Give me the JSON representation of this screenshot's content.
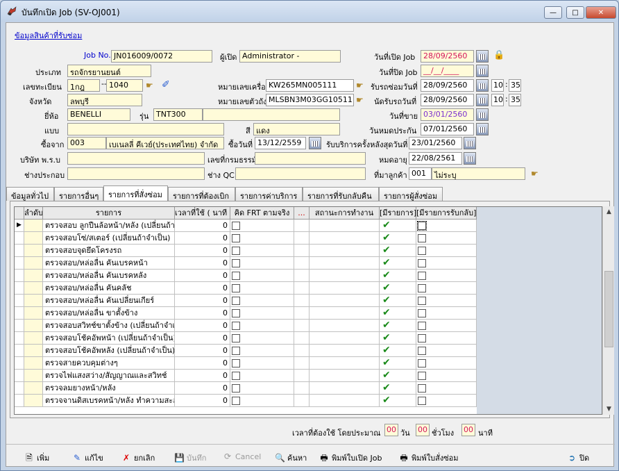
{
  "window": {
    "title": "บันทึกเปิด Job (SV-OJ001)",
    "controls": [
      "minimize",
      "maximize",
      "close"
    ]
  },
  "section_link": "ข้อมูลสินค้าที่รับซ่อม",
  "form": {
    "job_no_label": "Job No.",
    "job_no": "JN016009/0072",
    "opener_label": "ผู้เปิด",
    "opener": "Administrator -",
    "open_date_label": "วันที่เปิด Job",
    "open_date": "28/09/2560",
    "close_date_label": "วันที่ปิด Job",
    "close_date": "__/__/____",
    "type_label": "ประเภท",
    "type": "รถจักรยานยนต์",
    "plate_label": "เลขทะเบียน",
    "plate_prefix": "1กฎ",
    "plate_sep": "--",
    "plate_number": "1040",
    "engine_label": "หมายเลขเครื่อง",
    "engine_no": "KW265MN005111",
    "receive_date_label": "รับรถซ่อมวันที่",
    "receive_date": "28/09/2560",
    "receive_hour": "10",
    "receive_min": "35",
    "time_sep": ":",
    "province_label": "จังหวัด",
    "province": "ลพบุรี",
    "chassis_label": "หมายเลขตัวถัง",
    "chassis_no": "MLSBN3M03GG105111",
    "appoint_date_label": "นัดรับรถวันที่",
    "appoint_date": "28/09/2560",
    "appoint_hour": "10",
    "appoint_min": "35",
    "brand_label": "ยี่ห้อ",
    "brand": "BENELLI",
    "model_label": "รุ่น",
    "model": "TNT300",
    "sold_date_label": "วันที่ขาย",
    "sold_date": "03/01/2560",
    "style_label": "แบบ",
    "style": "",
    "color_label": "สี",
    "color": "แดง",
    "warranty_exp_label": "วันหมดประกัน",
    "warranty_exp": "07/01/2560",
    "buy_from_label": "ซื้อจาก",
    "buy_from_code": "003",
    "buy_from_name": "เบเนลลี่ คีเวย์(ประเทศไทย) จำกัด",
    "buy_date_label": "ซื้อวันที่",
    "buy_date": "13/12/2559",
    "last_service_label": "รับบริการครั้งหลังสุดวันที่",
    "last_service_date": "23/01/2560",
    "insurer_label": "บริษัท พ.ร.บ",
    "insurer": "",
    "policy_label": "เลขที่กรมธรรม์",
    "policy_no": "",
    "expire_label": "หมดอายุ",
    "expire_date": "22/08/2561",
    "assembler_label": "ช่างประกอบ",
    "assembler": "",
    "qc_label": "ช่าง QC",
    "qc": "",
    "customer_source_label": "ที่มาลูกค้า",
    "customer_source_code": "001",
    "customer_source_name": "ไม่ระบุ"
  },
  "tabs": [
    "ข้อมูลทั่วไป",
    "รายการอื่นๆ",
    "รายการที่สั่งซ่อม",
    "รายการที่ต้องเบิก",
    "รายการค่าบริการ",
    "รายการที่รับกลับคืน",
    "รายการผู้สั่งซ่อม"
  ],
  "active_tab": "รายการที่สั่งซ่อม",
  "grid": {
    "columns": [
      "ลำดับ",
      "รายการ",
      "เวลาที่ใช้ ( นาที )",
      "คิด FRT ตามจริง",
      "...",
      "สถานะการทำงาน",
      "[มีรายการ]",
      "[มีรายการรับกลับ]"
    ],
    "rows": [
      {
        "item": "ตรวจสอบ ลูกปืนล้อหน้า/หลัง (เปลี่ยนถ้าจำเป็น)",
        "minutes": "0",
        "has_item": true
      },
      {
        "item": "ตรวจสอบโซ่/สเตอร์ (เปลี่ยนถ้าจำเป็น)",
        "minutes": "0",
        "has_item": true
      },
      {
        "item": "ตรวจสอบจุดยึดโครงรถ",
        "minutes": "0",
        "has_item": true
      },
      {
        "item": "ตรวจสอบ/หล่อลื่น คันเบรคหน้า",
        "minutes": "0",
        "has_item": true
      },
      {
        "item": "ตรวจสอบ/หล่อลื่น คันเบรคหลัง",
        "minutes": "0",
        "has_item": true
      },
      {
        "item": "ตรวจสอบ/หล่อลื่น คันคลัช",
        "minutes": "0",
        "has_item": true
      },
      {
        "item": "ตรวจสอบ/หล่อลื่น คันเปลี่ยนเกียร์",
        "minutes": "0",
        "has_item": true
      },
      {
        "item": "ตรวจสอบ/หล่อลื่น ขาตั้งข้าง",
        "minutes": "0",
        "has_item": true
      },
      {
        "item": "ตรวจสอบสวิทช์ขาตั้งข้าง (เปลี่ยนถ้าจำเป็น)",
        "minutes": "0",
        "has_item": true
      },
      {
        "item": "ตรวจสอบโช้คอัพหน้า (เปลี่ยนถ้าจำเป็น)",
        "minutes": "0",
        "has_item": true
      },
      {
        "item": "ตรวจสอบโช้คอัพหลัง (เปลี่ยนถ้าจำเป็น)",
        "minutes": "0",
        "has_item": true
      },
      {
        "item": "ตรวจสายควบคุมต่างๆ",
        "minutes": "0",
        "has_item": true
      },
      {
        "item": "ตรวจไฟแสงสว่าง/สัญญาณและสวิทช์",
        "minutes": "0",
        "has_item": true
      },
      {
        "item": "ตรวจลมยางหน้า/หลัง",
        "minutes": "0",
        "has_item": true
      },
      {
        "item": "ตรวจจานดิสเบรคหน้า/หลัง ทำความสะอาด",
        "minutes": "0",
        "has_item": true
      }
    ]
  },
  "summary": {
    "label": "เวลาที่ต้องใช้ โดยประมาณ",
    "days": "00",
    "days_unit": "วัน",
    "hours": "00",
    "hours_unit": "ชั่วโมง",
    "minutes": "00",
    "minutes_unit": "นาที"
  },
  "toolbar": {
    "add": "เพิ่ม",
    "edit": "แก้ไข",
    "cancel_record": "ยกเลิก",
    "save": "บันทึก",
    "cancel": "Cancel",
    "search": "ค้นหา",
    "print_job": "พิมพ์ใบเปิด Job",
    "print_order": "พิมพ์ใบสั่งซ่อม",
    "close": "ปิด"
  },
  "colors": {
    "field_bg": "#fffbd9",
    "date_red": "#d4145a",
    "date_purple": "#7a2fd0",
    "link": "#0000cc",
    "check_green": "#1a8a1a"
  }
}
